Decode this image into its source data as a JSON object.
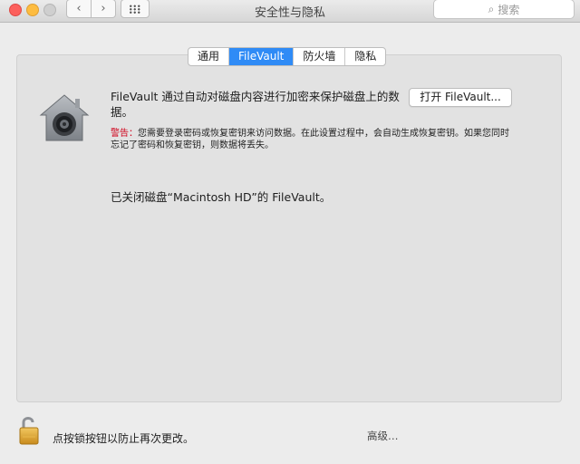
{
  "window": {
    "title": "安全性与隐私",
    "search_placeholder": "搜索",
    "back_icon": "chevron-left-icon",
    "forward_icon": "chevron-right-icon",
    "grid_icon": "grid-icon"
  },
  "tabs": [
    {
      "label": "通用",
      "active": false
    },
    {
      "label": "FileVault",
      "active": true
    },
    {
      "label": "防火墙",
      "active": false
    },
    {
      "label": "隐私",
      "active": false
    }
  ],
  "filevault": {
    "description": "FileVault 通过自动对磁盘内容进行加密来保护磁盘上的数据。",
    "open_button": "打开 FileVault...",
    "warning_label": "警告：",
    "warning_text": "您需要登录密码或恢复密钥来访问数据。在此设置过程中，会自动生成恢复密钥。如果您同时忘记了密码和恢复密钥，则数据将丢失。",
    "status": "已关闭磁盘“Macintosh HD”的 FileVault。"
  },
  "footer": {
    "lock_label": "点按锁按钮以防止再次更改。",
    "advanced_button": "高级…"
  },
  "colors": {
    "accent": "#2f8bf6",
    "warning": "#d0021b",
    "close": "#fc605c",
    "minimize": "#fdbc40"
  }
}
